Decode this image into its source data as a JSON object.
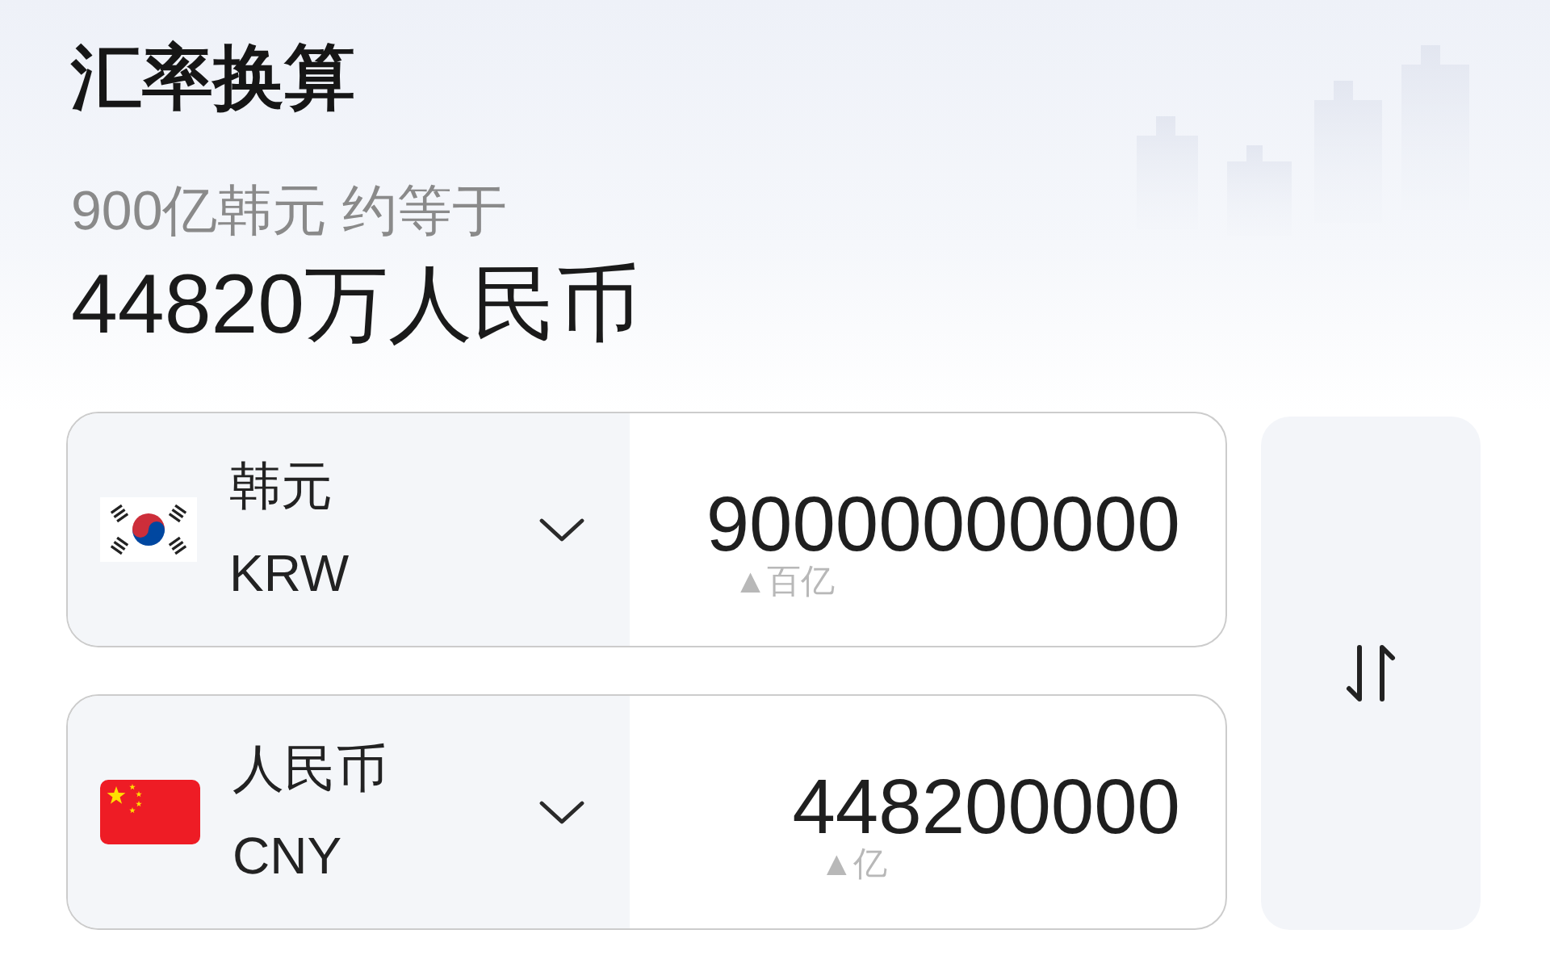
{
  "title": "汇率换算",
  "summary": {
    "caption": "900亿韩元 约等于",
    "result": "44820万人民币"
  },
  "currencies": [
    {
      "kind": "korea",
      "name": "韩元",
      "code": "KRW",
      "amount": "90000000000",
      "unit_hint": "▲百亿"
    },
    {
      "kind": "china",
      "name": "人民币",
      "code": "CNY",
      "amount": "448200000",
      "unit_hint": "▲亿"
    }
  ]
}
